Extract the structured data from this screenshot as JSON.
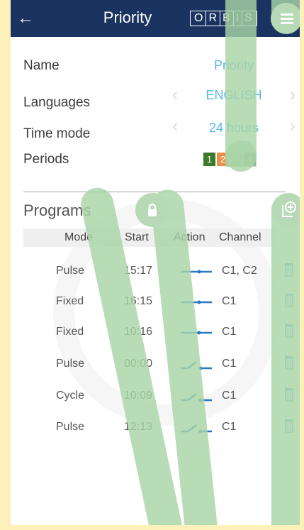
{
  "header": {
    "title": "Priority",
    "logo_letters": [
      "O",
      "R",
      "B",
      "I",
      "S"
    ]
  },
  "settings": {
    "name_label": "Name",
    "name_value": "Priority",
    "languages_label": "Languages",
    "languages_value": "ENGLISH",
    "time_mode_label": "Time mode",
    "time_mode_value": "24 hours",
    "periods_label": "Periods",
    "periods": [
      {
        "label": "1",
        "color": "#3b7a2a"
      },
      {
        "label": "2",
        "color": "#e9914b"
      },
      {
        "label": "3",
        "color": "#9a9ea8"
      },
      {
        "label": "4",
        "color": "#1e3966"
      }
    ]
  },
  "programs": {
    "title": "Programs",
    "columns": {
      "mode": "Mode",
      "start": "Start",
      "action": "Action",
      "channel": "Channel"
    },
    "rows": [
      {
        "mode": "Pulse",
        "start": "15:17",
        "action": "closed",
        "channel": "C1, C2"
      },
      {
        "mode": "Fixed",
        "start": "16:15",
        "action": "closed",
        "channel": "C1"
      },
      {
        "mode": "Fixed",
        "start": "10:16",
        "action": "closed",
        "channel": "C1"
      },
      {
        "mode": "Pulse",
        "start": "00:00",
        "action": "open",
        "channel": "C1"
      },
      {
        "mode": "Cycle",
        "start": "10:09",
        "action": "open",
        "channel": "C1"
      },
      {
        "mode": "Pulse",
        "start": "12:13",
        "action": "open",
        "channel": "C1"
      }
    ]
  },
  "icons": {
    "back": "arrow-left-icon",
    "menu": "hamburger-menu-icon",
    "lock": "lock-icon",
    "add": "add-program-icon",
    "delete": "trash-icon"
  },
  "colors": {
    "topbar": "#1b3360",
    "accent": "#59b7e8",
    "action_line": "#2a78c4",
    "trash": "#59b7e8",
    "overlay": "#a8d4a6"
  }
}
